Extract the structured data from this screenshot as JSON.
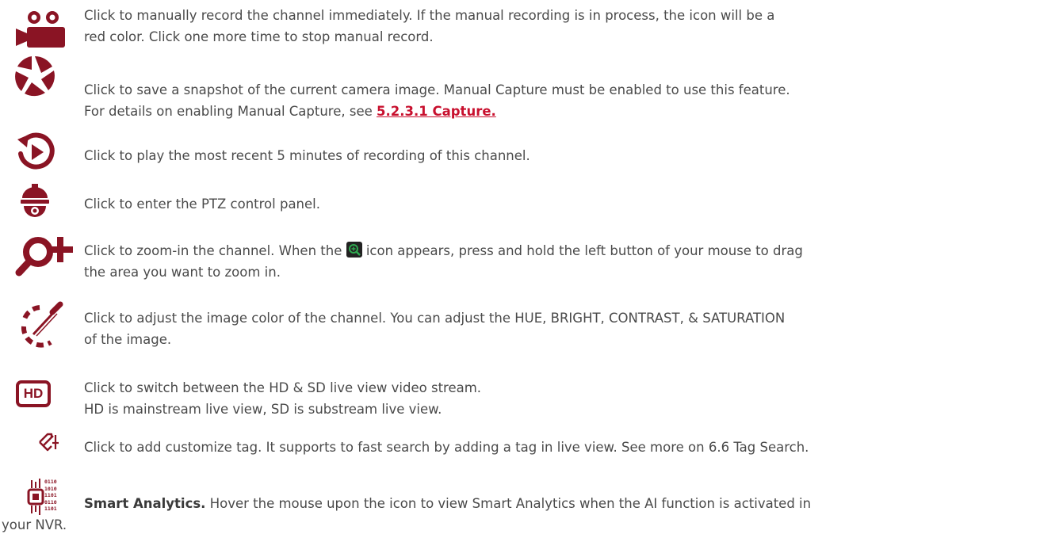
{
  "colors": {
    "icon": "#8a1424",
    "text": "#4a4a4a",
    "link": "#c8102e"
  },
  "rows": [
    {
      "icon": "manual-record-icon",
      "line1": "Click to manually record the channel immediately. If the manual recording is in process, the icon will be a",
      "line2": "red color. Click one more time to stop manual record."
    },
    {
      "icon": "snapshot-shutter-icon",
      "line1": "Click to save a snapshot of the current camera image. Manual Capture must be enabled to use this feature.",
      "line2_prefix": "For details on enabling Manual Capture, see ",
      "line2_link": "5.2.3.1 Capture."
    },
    {
      "icon": "instant-playback-icon",
      "line1": "Click to play the most recent 5 minutes of recording of this channel."
    },
    {
      "icon": "ptz-dome-camera-icon",
      "line1": "Click to enter the PTZ control panel."
    },
    {
      "icon": "zoom-in-icon",
      "line1_prefix": "Click to zoom-in the channel. When the ",
      "line1_suffix": " icon appears, press and hold the left button of your mouse to drag",
      "line2": "the area you want to zoom in."
    },
    {
      "icon": "color-picker-icon",
      "line1": "Click to adjust the image color of the channel. You can adjust the HUE, BRIGHT, CONTRAST, & SATURATION",
      "line2": "of the image."
    },
    {
      "icon": "hd-badge-icon",
      "icon_text": "HD",
      "line1": "Click to switch between the HD & SD live view video stream.",
      "line2": "HD is mainstream live view, SD is substream live view."
    },
    {
      "icon": "add-tag-icon",
      "line1": "Click to add customize tag. It supports to fast search by adding a tag in live view. See more on 6.6 Tag Search."
    },
    {
      "icon": "smart-analytics-chip-icon",
      "chip_bits": [
        "0110",
        "1010",
        "1101",
        "0110",
        "1101"
      ],
      "line1_bold": "Smart Analytics.",
      "line1_rest": " Hover the mouse upon the icon to view Smart Analytics when the AI function is activated in",
      "line2": "your NVR."
    }
  ]
}
